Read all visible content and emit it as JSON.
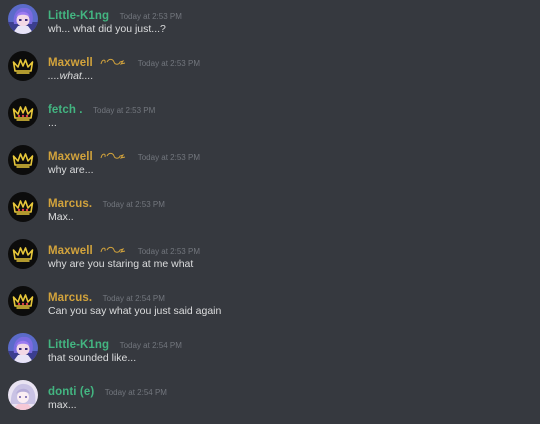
{
  "colors": {
    "background": "#36393f",
    "message_text": "#dcddde",
    "timestamp": "#72767d",
    "name_green": "#43b581",
    "name_gold": "#d2a33c"
  },
  "messages": [
    {
      "author": "Little-K1ng",
      "time": "Today at 2:53 PM",
      "text": "wh... what did you just...?",
      "avatar_icon": "anime-avatar-icon"
    },
    {
      "author": "Maxwell",
      "time": "Today at 2:53 PM",
      "text": "....what....",
      "avatar_icon": "crown-avatar-icon",
      "badge_icon": "scribble-decoration-icon"
    },
    {
      "author": "fetch .",
      "time": "Today at 2:53 PM",
      "text": "...",
      "avatar_icon": "crown-avatar-icon"
    },
    {
      "author": "Maxwell",
      "time": "Today at 2:53 PM",
      "text": "why are...",
      "avatar_icon": "crown-avatar-icon",
      "badge_icon": "scribble-decoration-icon"
    },
    {
      "author": "Marcus.",
      "time": "Today at 2:53 PM",
      "text": "Max..",
      "avatar_icon": "crown-avatar-icon"
    },
    {
      "author": "Maxwell",
      "time": "Today at 2:53 PM",
      "text": "why are you staring at me what",
      "avatar_icon": "crown-avatar-icon",
      "badge_icon": "scribble-decoration-icon"
    },
    {
      "author": "Marcus.",
      "time": "Today at 2:54 PM",
      "text": "Can you say what you just said again",
      "avatar_icon": "crown-avatar-icon"
    },
    {
      "author": "Little-K1ng",
      "time": "Today at 2:54 PM",
      "text": "that sounded like...",
      "avatar_icon": "anime-avatar-icon"
    },
    {
      "author": "donti (e)",
      "time": "Today at 2:54 PM",
      "text": "max...",
      "avatar_icon": "pastel-avatar-icon"
    }
  ]
}
